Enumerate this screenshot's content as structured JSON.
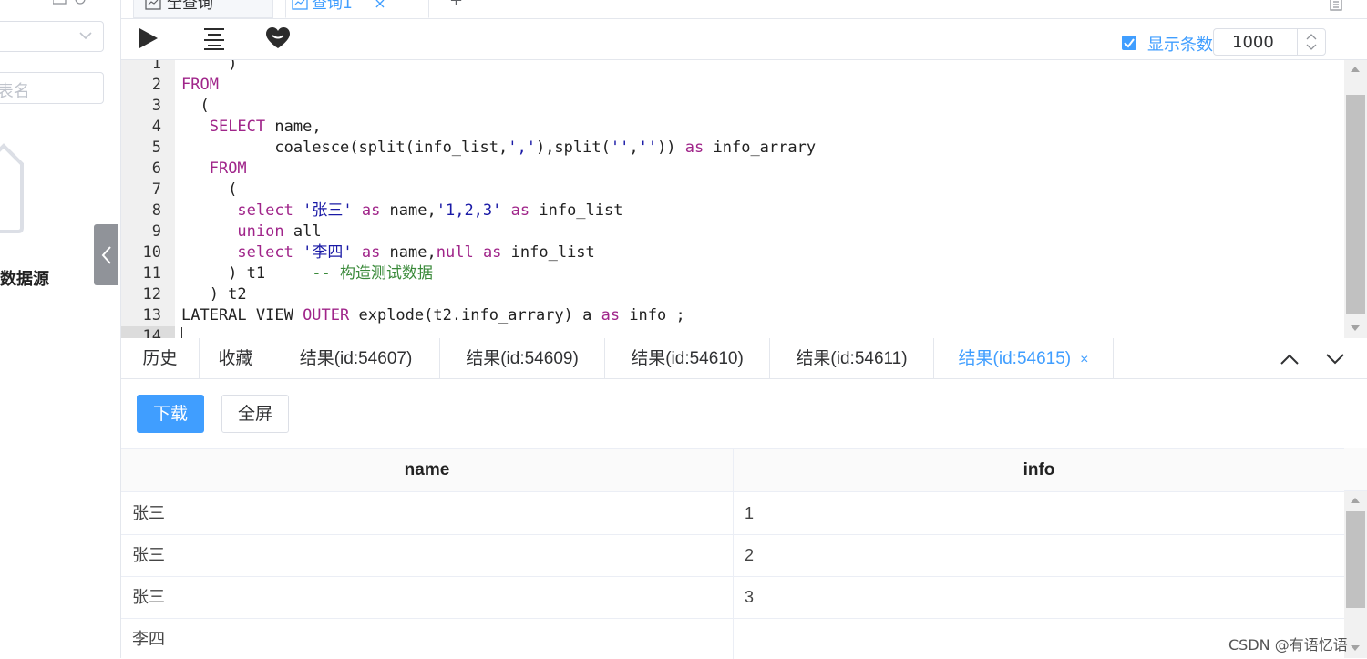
{
  "sidebar": {
    "search_placeholder": "库名.表名",
    "empty_text": "暂无数据源"
  },
  "top_tabs": [
    {
      "label": "全查询"
    },
    {
      "label": "查询1",
      "close": "×"
    }
  ],
  "top_tabs_add": "+",
  "toolbar": {
    "show_rows_label": "显示条数",
    "show_rows_checked": true,
    "row_count": "1000"
  },
  "editor": {
    "lines": [
      {
        "n": "1",
        "tokens": [
          {
            "t": "     )",
            "c": ""
          }
        ]
      },
      {
        "n": "2",
        "tokens": [
          {
            "t": "FROM",
            "c": "kw"
          }
        ]
      },
      {
        "n": "3",
        "tokens": [
          {
            "t": "  (",
            "c": ""
          }
        ]
      },
      {
        "n": "4",
        "tokens": [
          {
            "t": "   ",
            "c": ""
          },
          {
            "t": "SELECT",
            "c": "kw"
          },
          {
            "t": " name,",
            "c": ""
          }
        ]
      },
      {
        "n": "5",
        "tokens": [
          {
            "t": "          coalesce(split(info_list,",
            "c": ""
          },
          {
            "t": "','",
            "c": "str"
          },
          {
            "t": "),split(",
            "c": ""
          },
          {
            "t": "''",
            "c": "str"
          },
          {
            "t": ",",
            "c": ""
          },
          {
            "t": "''",
            "c": "str"
          },
          {
            "t": ")) ",
            "c": ""
          },
          {
            "t": "as",
            "c": "kw"
          },
          {
            "t": " info_arrary",
            "c": ""
          }
        ]
      },
      {
        "n": "6",
        "tokens": [
          {
            "t": "   ",
            "c": ""
          },
          {
            "t": "FROM",
            "c": "kw"
          }
        ]
      },
      {
        "n": "7",
        "tokens": [
          {
            "t": "     (",
            "c": ""
          }
        ]
      },
      {
        "n": "8",
        "tokens": [
          {
            "t": "      ",
            "c": ""
          },
          {
            "t": "select",
            "c": "kw"
          },
          {
            "t": " ",
            "c": ""
          },
          {
            "t": "'张三'",
            "c": "str"
          },
          {
            "t": " ",
            "c": ""
          },
          {
            "t": "as",
            "c": "kw"
          },
          {
            "t": " name,",
            "c": ""
          },
          {
            "t": "'1,2,3'",
            "c": "str"
          },
          {
            "t": " ",
            "c": ""
          },
          {
            "t": "as",
            "c": "kw"
          },
          {
            "t": " info_list",
            "c": ""
          }
        ]
      },
      {
        "n": "9",
        "tokens": [
          {
            "t": "      ",
            "c": ""
          },
          {
            "t": "union",
            "c": "kw"
          },
          {
            "t": " all",
            "c": ""
          }
        ]
      },
      {
        "n": "10",
        "tokens": [
          {
            "t": "      ",
            "c": ""
          },
          {
            "t": "select",
            "c": "kw"
          },
          {
            "t": " ",
            "c": ""
          },
          {
            "t": "'李四'",
            "c": "str"
          },
          {
            "t": " ",
            "c": ""
          },
          {
            "t": "as",
            "c": "kw"
          },
          {
            "t": " name,",
            "c": ""
          },
          {
            "t": "null",
            "c": "kw"
          },
          {
            "t": " ",
            "c": ""
          },
          {
            "t": "as",
            "c": "kw"
          },
          {
            "t": " info_list",
            "c": ""
          }
        ]
      },
      {
        "n": "11",
        "tokens": [
          {
            "t": "     ) t1     ",
            "c": ""
          },
          {
            "t": "-- 构造测试数据",
            "c": "cmt"
          }
        ]
      },
      {
        "n": "12",
        "tokens": [
          {
            "t": "   ) t2",
            "c": ""
          }
        ]
      },
      {
        "n": "13",
        "tokens": [
          {
            "t": "LATERAL VIEW ",
            "c": ""
          },
          {
            "t": "OUTER",
            "c": "kw"
          },
          {
            "t": " explode(t2.info_arrary) a ",
            "c": ""
          },
          {
            "t": "as",
            "c": "kw"
          },
          {
            "t": " info ;",
            "c": ""
          }
        ]
      },
      {
        "n": "14",
        "tokens": [],
        "current": true
      }
    ]
  },
  "result_tabs": [
    {
      "label": "历史"
    },
    {
      "label": "收藏"
    },
    {
      "label": "结果(id:54607)"
    },
    {
      "label": "结果(id:54609)"
    },
    {
      "label": "结果(id:54610)"
    },
    {
      "label": "结果(id:54611)"
    },
    {
      "label": "结果(id:54615)",
      "active": true,
      "close": "×"
    }
  ],
  "actions": {
    "download": "下载",
    "fullscreen": "全屏"
  },
  "table": {
    "columns": [
      "name",
      "info"
    ],
    "rows": [
      [
        "张三",
        "1"
      ],
      [
        "张三",
        "2"
      ],
      [
        "张三",
        "3"
      ],
      [
        "李四",
        ""
      ]
    ]
  },
  "watermark": "CSDN @有语忆语",
  "colors": {
    "accent": "#409eff",
    "keyword": "#a0258a",
    "string": "#1a1aa6",
    "comment": "#3a8a3a"
  }
}
